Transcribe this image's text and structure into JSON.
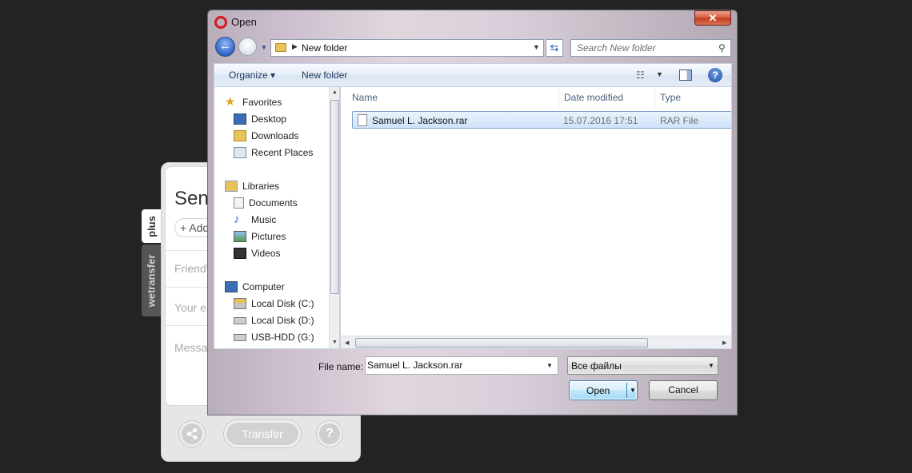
{
  "wetransfer": {
    "title": "Send",
    "add_label": "+ Add",
    "friends_placeholder": "Friend's",
    "email_placeholder": "Your em",
    "message_placeholder": "Messag",
    "transfer_label": "Transfer",
    "help_label": "?",
    "tab_plus": "plus",
    "tab_brand": "wetransfer"
  },
  "dialog": {
    "title": "Open",
    "close_label": "✕",
    "address": {
      "current_folder": "New folder"
    },
    "search": {
      "placeholder": "Search New folder"
    },
    "toolbar": {
      "organize": "Organize ▾",
      "new_folder": "New folder",
      "help": "?"
    },
    "nav": {
      "favorites": {
        "label": "Favorites",
        "items": [
          "Desktop",
          "Downloads",
          "Recent Places"
        ]
      },
      "libraries": {
        "label": "Libraries",
        "items": [
          "Documents",
          "Music",
          "Pictures",
          "Videos"
        ]
      },
      "computer": {
        "label": "Computer",
        "items": [
          "Local Disk (C:)",
          "Local Disk (D:)",
          "USB-HDD (G:)"
        ]
      }
    },
    "columns": [
      "Name",
      "Date modified",
      "Type"
    ],
    "files": [
      {
        "name": "Samuel L. Jackson.rar",
        "date": "15.07.2016 17:51",
        "type": "RAR File"
      }
    ],
    "file_name_label": "File name:",
    "file_name_value": "Samuel L. Jackson.rar",
    "file_type_value": "Все файлы",
    "open_label": "Open",
    "cancel_label": "Cancel"
  },
  "colors": {
    "background": "#232323",
    "close_button": "#c4381a",
    "selection": "#cfe3fa",
    "opera_red": "#d8171e"
  },
  "icons": [
    "opera-icon",
    "back-arrow-icon",
    "forward-arrow-icon",
    "folder-icon",
    "refresh-icon",
    "search-icon",
    "views-icon",
    "preview-pane-icon",
    "help-icon",
    "star-icon",
    "desktop-icon",
    "downloads-icon",
    "recent-places-icon",
    "libraries-icon",
    "documents-icon",
    "music-icon",
    "pictures-icon",
    "videos-icon",
    "computer-icon",
    "drive-icon",
    "file-icon",
    "share-icon"
  ]
}
